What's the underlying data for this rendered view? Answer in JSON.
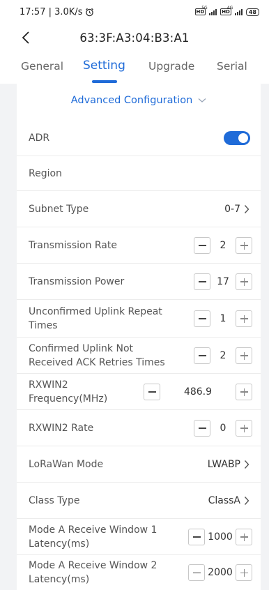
{
  "status_bar": {
    "time_speed": "17:57 | 3.0K/s",
    "sig1_label": "5G",
    "sig2_label": "4G",
    "battery": "48"
  },
  "header": {
    "title": "63:3F:A3:04:B3:A1"
  },
  "tabs": [
    {
      "label": "General"
    },
    {
      "label": "Setting"
    },
    {
      "label": "Upgrade"
    },
    {
      "label": "Serial"
    }
  ],
  "colors": {
    "accent": "#1f6bd8"
  },
  "section": {
    "title": "Advanced Configuration"
  },
  "rows": [
    {
      "label": "ADR",
      "control": "toggle",
      "toggle_on": true
    },
    {
      "label": "Region",
      "control": "none"
    },
    {
      "label": "Subnet Type",
      "control": "select",
      "value": "0-7"
    },
    {
      "label": "Transmission Rate",
      "control": "stepper",
      "value": "2"
    },
    {
      "label": "Transmission Power",
      "control": "stepper",
      "value": "17"
    },
    {
      "label": "Unconfirmed Uplink Repeat Times",
      "control": "stepper",
      "value": "1"
    },
    {
      "label": "Confirmed Uplink Not Received ACK Retries Times",
      "control": "stepper",
      "value": "2"
    },
    {
      "label": "RXWIN2 Frequency(MHz)",
      "control": "stepper",
      "value": "486.9"
    },
    {
      "label": "RXWIN2 Rate",
      "control": "stepper",
      "value": "0"
    },
    {
      "label": "LoRaWan Mode",
      "control": "select",
      "value": "LWABP"
    },
    {
      "label": "Class Type",
      "control": "select",
      "value": "ClassA"
    },
    {
      "label": "Mode A Receive Window 1 Latency(ms)",
      "control": "stepper",
      "value": "1000"
    },
    {
      "label": "Mode A Receive Window 2 Latency(ms)",
      "control": "stepper",
      "value": "2000"
    }
  ]
}
